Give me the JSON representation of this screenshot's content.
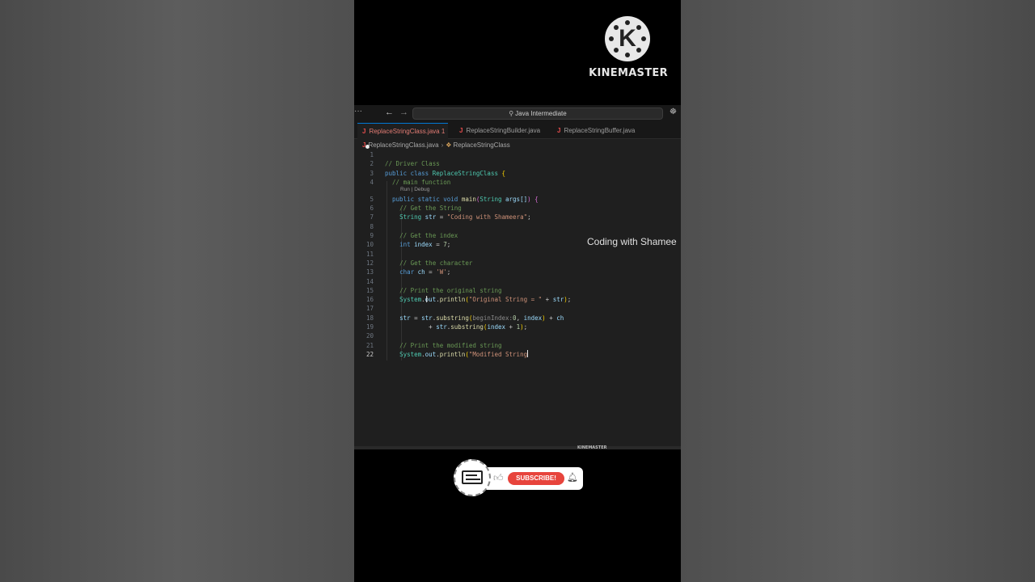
{
  "watermark": {
    "brand": "KINEMASTER",
    "brand_small": "KINEMASTER",
    "logo_letter": "K"
  },
  "ide": {
    "title_more": "···",
    "search_text": "Java Intermediate",
    "tabs": [
      {
        "label": "ReplaceStringClass.java 1",
        "active": true
      },
      {
        "label": "ReplaceStringBuilder.java",
        "active": false
      },
      {
        "label": "ReplaceStringBuffer.java",
        "active": false
      }
    ],
    "breadcrumb": {
      "file": "ReplaceStringClass.java",
      "symbol": "ReplaceStringClass"
    },
    "codelens": "Run | Debug",
    "line_numbers": [
      "1",
      "2",
      "3",
      "4",
      "5",
      "6",
      "7",
      "8",
      "9",
      "10",
      "11",
      "12",
      "13",
      "14",
      "15",
      "16",
      "17",
      "18",
      "19",
      "20",
      "21",
      "22"
    ],
    "code": {
      "l2": "// Driver Class",
      "l3_kw": "public class",
      "l3_name": "ReplaceStringClass",
      "l4": "// main function",
      "l5_kw": "public static void",
      "l5_fn": "main",
      "l5_type": "String",
      "l5_var": "args[]",
      "l6": "// Get the String",
      "l7_type": "String",
      "l7_var": "str",
      "l7_str": "\"Coding with Shameera\"",
      "l9": "// Get the index",
      "l10_kw": "int",
      "l10_var": "index",
      "l10_num": "7",
      "l12": "// Get the character",
      "l13_kw": "char",
      "l13_var": "ch",
      "l13_str": "'W'",
      "l15": "// Print the original string",
      "l16_sys": "System",
      "l16_out": "out",
      "l16_fn": "println",
      "l16_str": "\"Original String = \"",
      "l16_var": "str",
      "l18_var1": "str",
      "l18_var2": "str",
      "l18_fn": "substring",
      "l18_hint": "beginIndex:",
      "l18_num": "0",
      "l18_var3": "index",
      "l18_var4": "ch",
      "l19_var1": "str",
      "l19_fn": "substring",
      "l19_var2": "index",
      "l19_num": "1",
      "l21": "// Print the modified string",
      "l22_sys": "System",
      "l22_out": "out",
      "l22_fn": "println",
      "l22_str": "\"Modified String"
    }
  },
  "overlay_text": "Coding with Shamee",
  "subscribe": {
    "button_label": "SUBSCRIBE!"
  }
}
